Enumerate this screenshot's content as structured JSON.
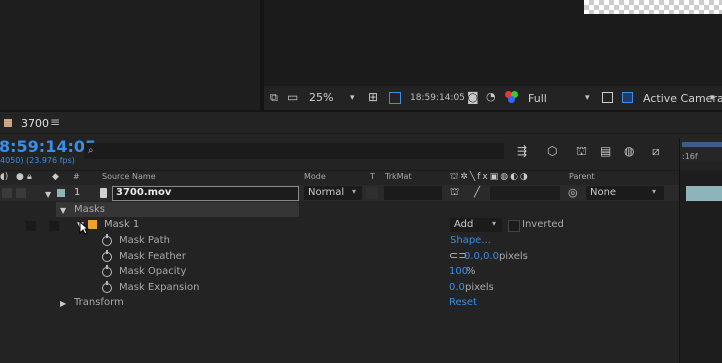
{
  "viewer": {
    "zoom": "25%",
    "timecode": "18:59:14:05",
    "resolution": "Full",
    "camera": "Active Camera"
  },
  "comp": {
    "name": "3700",
    "menu_icon": "≡",
    "timecode": "8:59:14:05",
    "frame_info": "4050) (23.976 fps)",
    "search_placeholder": "",
    "ruler_label": ":16f"
  },
  "columns": {
    "num": "#",
    "source_name": "Source Name",
    "mode": "Mode",
    "t": "T",
    "trkmat": "TrkMat",
    "parent": "Parent"
  },
  "layer": {
    "index": "1",
    "name": "3700.mov",
    "mode": "Normal",
    "parent": "None"
  },
  "masks_group": "Masks",
  "mask": {
    "name": "Mask 1",
    "mode": "Add",
    "inverted_label": "Inverted",
    "properties": [
      {
        "label": "Mask Path",
        "value": "Shape...",
        "unit": ""
      },
      {
        "label": "Mask Feather",
        "value": "0.0,0.0",
        "unit": "pixels"
      },
      {
        "label": "Mask Opacity",
        "value": "100",
        "unit": "%"
      },
      {
        "label": "Mask Expansion",
        "value": "0.0",
        "unit": "pixels"
      }
    ]
  },
  "transform": {
    "label": "Transform",
    "value": "Reset"
  },
  "colors": {
    "accent": "#3a8ee6",
    "label_orange": "#f0a030",
    "label_teal": "#8fb3ba"
  }
}
